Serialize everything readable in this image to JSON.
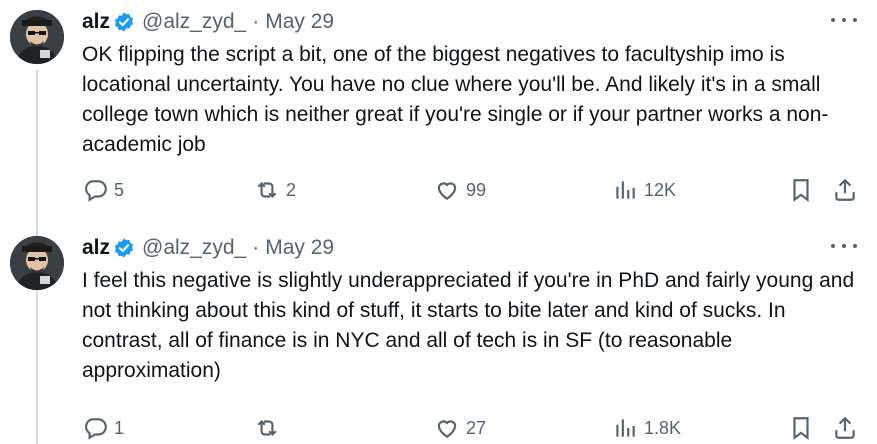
{
  "tweets": [
    {
      "author": {
        "name": "alz",
        "handle": "@alz_zyd_",
        "verified": true
      },
      "separator": "·",
      "date": "May 29",
      "text": "OK flipping the script a bit, one of the biggest negatives to facultyship imo is locational uncertainty. You have no clue where you'll be. And likely it's in a small college town which is neither great if you're single or if your partner works a non-academic job",
      "stats": {
        "replies": "5",
        "reposts": "2",
        "likes": "99",
        "views": "12K"
      }
    },
    {
      "author": {
        "name": "alz",
        "handle": "@alz_zyd_",
        "verified": true
      },
      "separator": "·",
      "date": "May 29",
      "text": "I feel this negative is slightly underappreciated if you're in PhD and fairly young and not thinking about this kind of stuff, it starts to bite later and kind of sucks. In contrast, all of finance is in NYC and all of tech is in SF (to reasonable approximation)",
      "stats": {
        "replies": "1",
        "reposts": "",
        "likes": "27",
        "views": "1.8K"
      }
    }
  ],
  "icons": {
    "reply": "reply-icon",
    "repost": "repost-icon",
    "like": "heart-icon",
    "views": "views-icon",
    "bookmark": "bookmark-icon",
    "share": "share-icon",
    "more": "more-icon",
    "verified": "verified-badge-icon"
  },
  "colors": {
    "text": "#0f1419",
    "secondary": "#536471",
    "verified": "#1d9bf0",
    "thread_line": "#cfd9de"
  }
}
